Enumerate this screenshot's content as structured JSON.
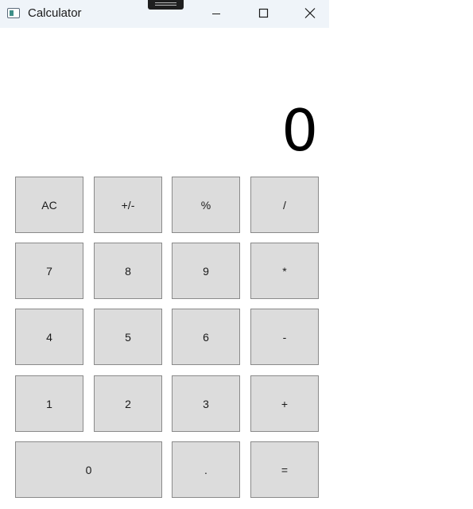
{
  "window": {
    "title": "Calculator"
  },
  "display": {
    "value": "0"
  },
  "keys": {
    "clear": "AC",
    "negate": "+/-",
    "percent": "%",
    "divide": "/",
    "seven": "7",
    "eight": "8",
    "nine": "9",
    "multiply": "*",
    "four": "4",
    "five": "5",
    "six": "6",
    "subtract": "-",
    "one": "1",
    "two": "2",
    "three": "3",
    "add": "+",
    "zero": "0",
    "decimal": ".",
    "equals": "="
  },
  "icons": {
    "app": "calculator-app-icon",
    "minimize": "minimize-icon",
    "maximize": "maximize-icon",
    "close": "close-icon",
    "drag": "drag-handle-icon"
  },
  "colors": {
    "titlebar": "#eff4f9",
    "key_background": "#dcdcdc",
    "key_border": "#8a8a8a"
  }
}
